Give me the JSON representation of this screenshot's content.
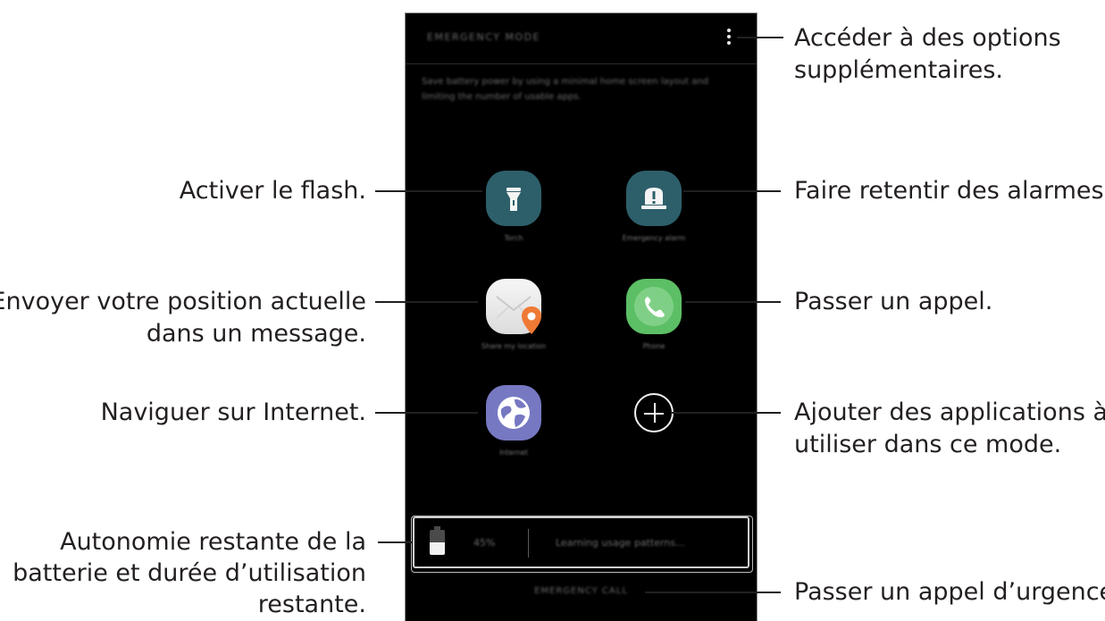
{
  "screen": {
    "title": "EMERGENCY MODE",
    "description": "Save battery power by using a minimal home screen layout and limiting the number of usable apps.",
    "apps": [
      {
        "label": "Torch"
      },
      {
        "label": "Emergency alarm"
      },
      {
        "label": "Share my location"
      },
      {
        "label": "Phone"
      },
      {
        "label": "Internet"
      }
    ],
    "battery_percent": "45%",
    "usage_text": "Learning usage patterns...",
    "emergency_call": "EMERGENCY CALL"
  },
  "callouts": {
    "options": [
      "Accéder à des options",
      "supplémentaires."
    ],
    "flash": "Activer le flash.",
    "alarms": "Faire retentir des alarmes.",
    "location": [
      "Envoyer votre position actuelle",
      "dans un message."
    ],
    "call": "Passer un appel.",
    "internet": "Naviguer sur Internet.",
    "add_apps": [
      "Ajouter des applications à",
      "utiliser dans ce mode."
    ],
    "battery": [
      "Autonomie restante de la",
      "batterie et durée d’utilisation",
      "restante."
    ],
    "emergency_call": "Passer un appel d’urgence."
  },
  "colors": {
    "torch_icon": "#2d5f6a",
    "alarm_icon": "#2d5f6a",
    "phone_icon": "#5cbf65",
    "internet_icon": "#7678c2",
    "location_pin": "#ef7a35"
  }
}
